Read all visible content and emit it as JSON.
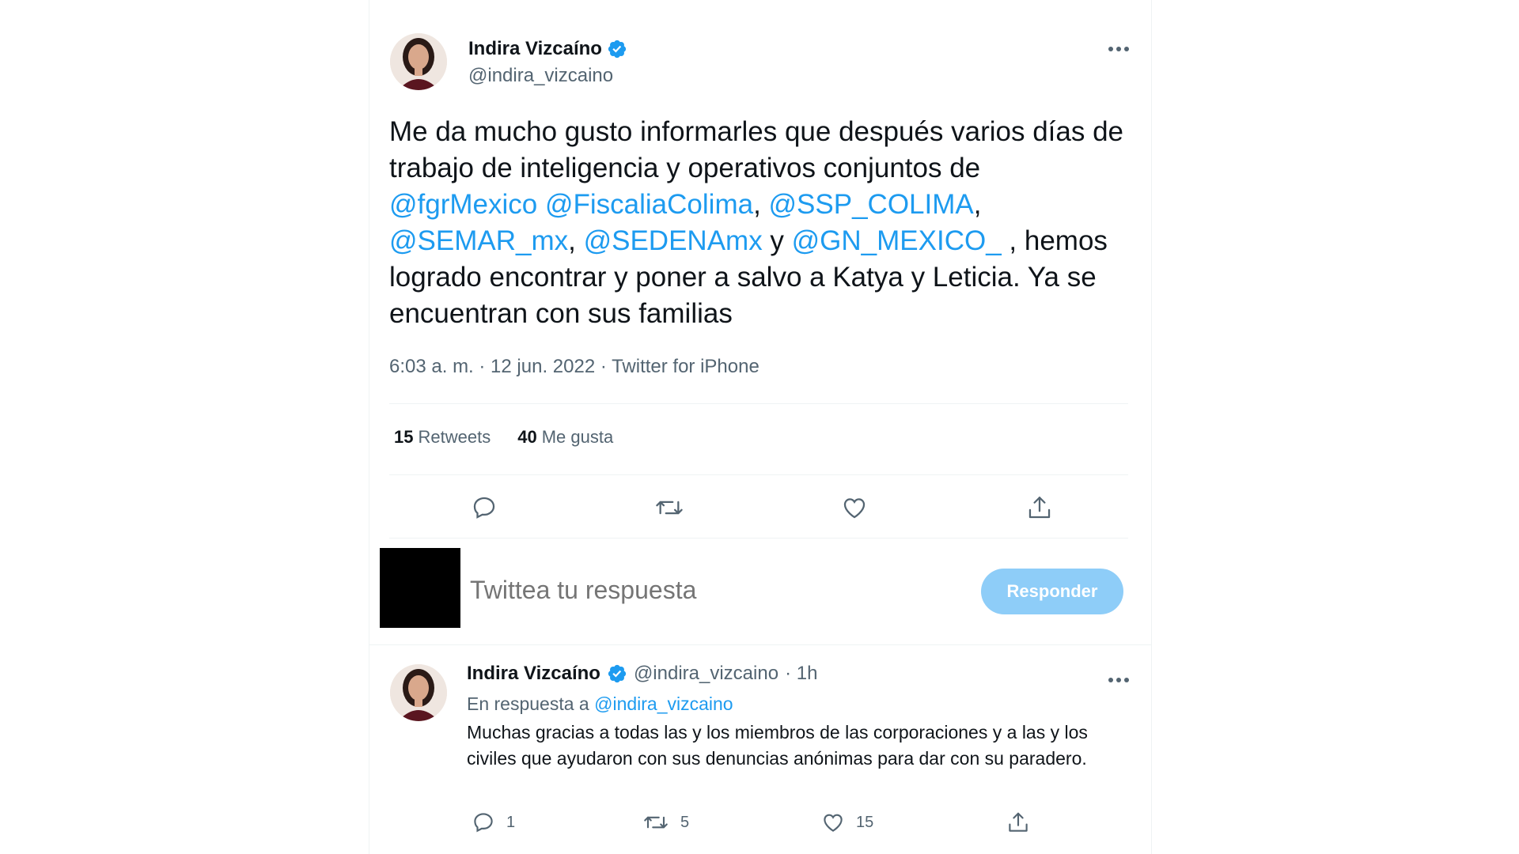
{
  "tweet": {
    "author_name": "Indira Vizcaíno",
    "author_handle": "@indira_vizcaino",
    "text_parts": [
      "Me da mucho gusto informarles que  después varios días de trabajo de inteligencia y operativos conjuntos de ",
      "@fgrMexico",
      " ",
      "@FiscaliaColima",
      ", ",
      "@SSP_COLIMA",
      ", ",
      "@SEMAR_mx",
      ", ",
      "@SEDENAmx",
      " y ",
      "@GN_MEXICO_",
      " , hemos logrado encontrar y poner a salvo a Katya y Leticia. Ya se encuentran con sus familias"
    ],
    "meta": "6:03 a. m. · 12 jun. 2022 · Twitter for iPhone",
    "retweets_count": "15",
    "retweets_label": "Retweets",
    "likes_count": "40",
    "likes_label": "Me gusta"
  },
  "compose": {
    "placeholder": "Twittea tu respuesta",
    "button_label": "Responder"
  },
  "reply": {
    "author_name": "Indira Vizcaíno",
    "author_handle": "@indira_vizcaino",
    "time": "· 1h",
    "in_reply_prefix": "En respuesta a ",
    "in_reply_handle": "@indira_vizcaino",
    "text": "Muchas gracias a todas las y los miembros de las corporaciones y a las y los civiles  que ayudaron con sus denuncias anónimas para dar con su paradero.",
    "replies": "1",
    "retweets": "5",
    "likes": "15"
  },
  "colors": {
    "accent": "#1d9bf0",
    "secondary_text": "#536471",
    "button_disabled": "#8ecdf8"
  },
  "icons": [
    "verified-badge-icon",
    "more-icon",
    "reply-icon",
    "retweet-icon",
    "like-icon",
    "share-icon"
  ]
}
